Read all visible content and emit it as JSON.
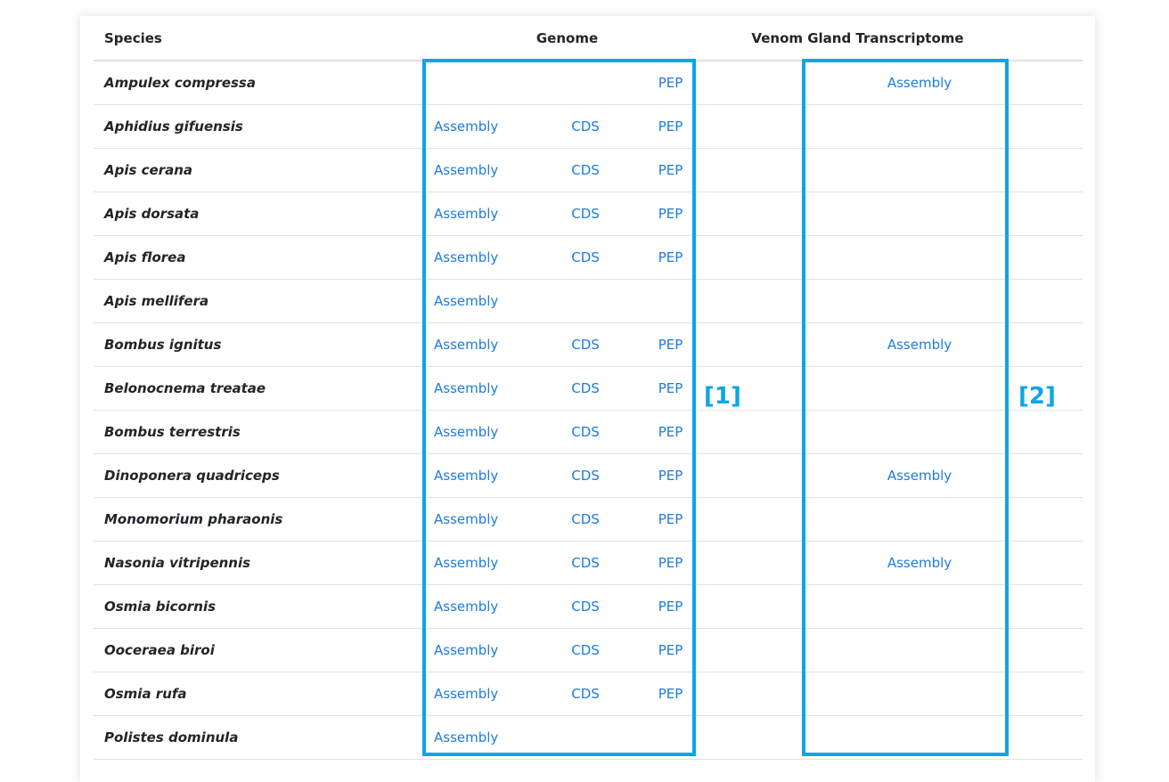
{
  "table": {
    "headers": {
      "species": "Species",
      "genome": "Genome",
      "venom": "Venom Gland Transcriptome"
    },
    "rows": [
      {
        "species": "Ampulex compressa",
        "genome_assembly": "",
        "genome_cds": "",
        "genome_pep": "PEP",
        "venom_assembly": "Assembly"
      },
      {
        "species": "Aphidius gifuensis",
        "genome_assembly": "Assembly",
        "genome_cds": "CDS",
        "genome_pep": "PEP",
        "venom_assembly": ""
      },
      {
        "species": "Apis cerana",
        "genome_assembly": "Assembly",
        "genome_cds": "CDS",
        "genome_pep": "PEP",
        "venom_assembly": ""
      },
      {
        "species": "Apis dorsata",
        "genome_assembly": "Assembly",
        "genome_cds": "CDS",
        "genome_pep": "PEP",
        "venom_assembly": ""
      },
      {
        "species": "Apis florea",
        "genome_assembly": "Assembly",
        "genome_cds": "CDS",
        "genome_pep": "PEP",
        "venom_assembly": ""
      },
      {
        "species": "Apis mellifera",
        "genome_assembly": "Assembly",
        "genome_cds": "",
        "genome_pep": "",
        "venom_assembly": ""
      },
      {
        "species": "Bombus ignitus",
        "genome_assembly": "Assembly",
        "genome_cds": "CDS",
        "genome_pep": "PEP",
        "venom_assembly": "Assembly"
      },
      {
        "species": "Belonocnema treatae",
        "genome_assembly": "Assembly",
        "genome_cds": "CDS",
        "genome_pep": "PEP",
        "venom_assembly": ""
      },
      {
        "species": "Bombus terrestris",
        "genome_assembly": "Assembly",
        "genome_cds": "CDS",
        "genome_pep": "PEP",
        "venom_assembly": ""
      },
      {
        "species": "Dinoponera quadriceps",
        "genome_assembly": "Assembly",
        "genome_cds": "CDS",
        "genome_pep": "PEP",
        "venom_assembly": "Assembly"
      },
      {
        "species": "Monomorium pharaonis",
        "genome_assembly": "Assembly",
        "genome_cds": "CDS",
        "genome_pep": "PEP",
        "venom_assembly": ""
      },
      {
        "species": "Nasonia vitripennis",
        "genome_assembly": "Assembly",
        "genome_cds": "CDS",
        "genome_pep": "PEP",
        "venom_assembly": "Assembly"
      },
      {
        "species": "Osmia bicornis",
        "genome_assembly": "Assembly",
        "genome_cds": "CDS",
        "genome_pep": "PEP",
        "venom_assembly": ""
      },
      {
        "species": "Ooceraea biroi",
        "genome_assembly": "Assembly",
        "genome_cds": "CDS",
        "genome_pep": "PEP",
        "venom_assembly": ""
      },
      {
        "species": "Osmia rufa",
        "genome_assembly": "Assembly",
        "genome_cds": "CDS",
        "genome_pep": "PEP",
        "venom_assembly": ""
      },
      {
        "species": "Polistes dominula",
        "genome_assembly": "Assembly",
        "genome_cds": "",
        "genome_pep": "",
        "venom_assembly": ""
      }
    ]
  },
  "annotations": {
    "box1_label": "[1]",
    "box2_label": "[2]"
  },
  "colors": {
    "link": "#1e7be0",
    "highlight": "#0aa6e6",
    "border": "#dee2e6",
    "text": "#212529"
  }
}
